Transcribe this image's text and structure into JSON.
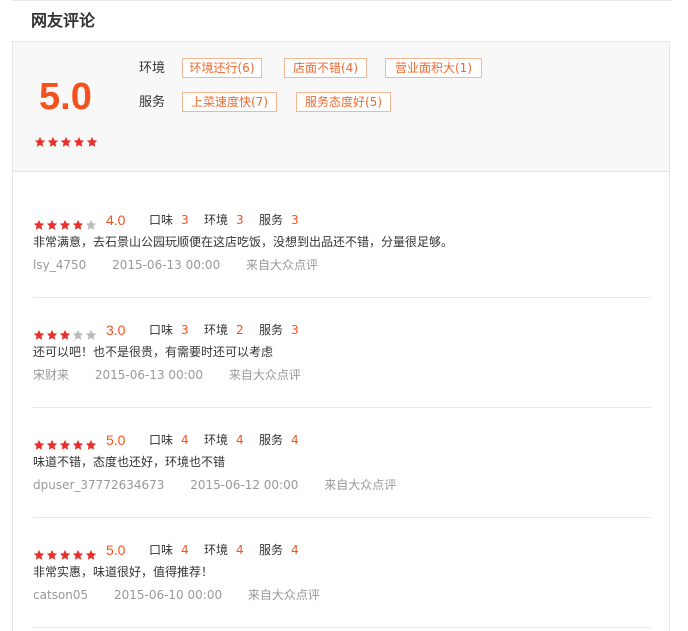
{
  "section_title": "网友评论",
  "summary": {
    "score": "5.0",
    "stars": 5,
    "rows": [
      {
        "label": "环境",
        "tags": [
          "环境还行(6)",
          "店面不错(4)",
          "营业面积大(1)"
        ]
      },
      {
        "label": "服务",
        "tags": [
          "上菜速度快(7)",
          "服务态度好(5)"
        ]
      }
    ]
  },
  "colors": {
    "accent": "#f4511e",
    "star_on": "#e8312a",
    "star_off": "#bbbbbb",
    "tag_border": "#f5b896"
  },
  "reviews": [
    {
      "stars": 4,
      "score": "4.0",
      "taste_label": "口味",
      "taste": "3",
      "env_label": "环境",
      "env": "3",
      "service_label": "服务",
      "service": "3",
      "text": "非常满意，去石景山公园玩顺便在这店吃饭，没想到出品还不错，分量很足够。",
      "user": "lsy_4750",
      "date": "2015-06-13 00:00",
      "source": "来自大众点评"
    },
    {
      "stars": 3,
      "score": "3.0",
      "taste_label": "口味",
      "taste": "3",
      "env_label": "环境",
      "env": "2",
      "service_label": "服务",
      "service": "3",
      "text": "还可以吧！也不是很贵，有需要时还可以考虑",
      "user": "宋财来",
      "date": "2015-06-13 00:00",
      "source": "来自大众点评"
    },
    {
      "stars": 5,
      "score": "5.0",
      "taste_label": "口味",
      "taste": "4",
      "env_label": "环境",
      "env": "4",
      "service_label": "服务",
      "service": "4",
      "text": "味道不错，态度也还好，环境也不错",
      "user": "dpuser_37772634673",
      "date": "2015-06-12 00:00",
      "source": "来自大众点评"
    },
    {
      "stars": 5,
      "score": "5.0",
      "taste_label": "口味",
      "taste": "4",
      "env_label": "环境",
      "env": "4",
      "service_label": "服务",
      "service": "4",
      "text": "非常实惠，味道很好，值得推荐！",
      "user": "catson05",
      "date": "2015-06-10 00:00",
      "source": "来自大众点评"
    }
  ]
}
